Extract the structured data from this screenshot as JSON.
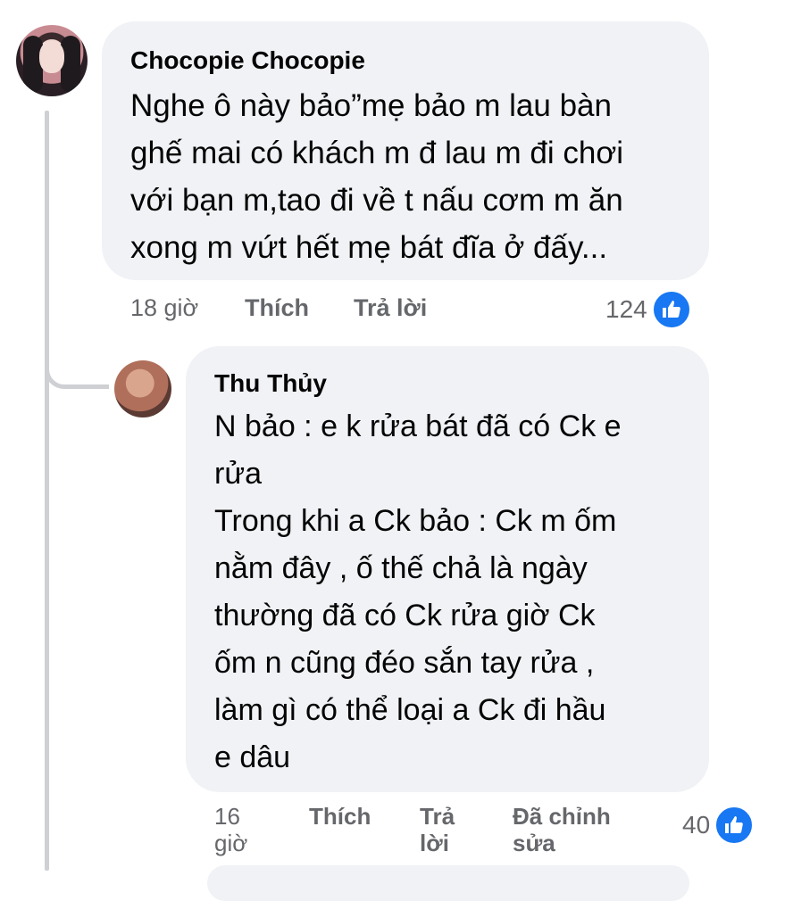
{
  "comment": {
    "author": "Chocopie Chocopie",
    "text": "Nghe ô này bảo”mẹ bảo m lau bàn\nghế mai có khách m đ lau m đi chơi\nvới bạn m,tao đi về t nấu cơm m ăn\nxong m vứt hết mẹ bát đĩa ở đấy...",
    "time": "18 giờ",
    "like_label": "Thích",
    "reply_label": "Trả lời",
    "reaction_count": "124"
  },
  "reply": {
    "author": "Thu Thủy",
    "text": "N bảo : e k rửa bát đã có Ck e\nrửa\nTrong khi a Ck bảo : Ck m ốm\nnằm đây , ố thế chả là ngày\nthường đã có Ck rửa giờ Ck\nốm n cũng đéo sắn tay rửa ,\nlàm gì có thể loại a Ck đi hầu\ne dâu",
    "time": "16\ngiờ",
    "like_label": "Thích",
    "reply_label": "Trả\nlời",
    "edited_label": "Đã chỉnh\nsửa",
    "reaction_count": "40"
  },
  "icons": {
    "reaction": "like-thumbs-up-icon",
    "reaction_color": "#1877f2"
  }
}
